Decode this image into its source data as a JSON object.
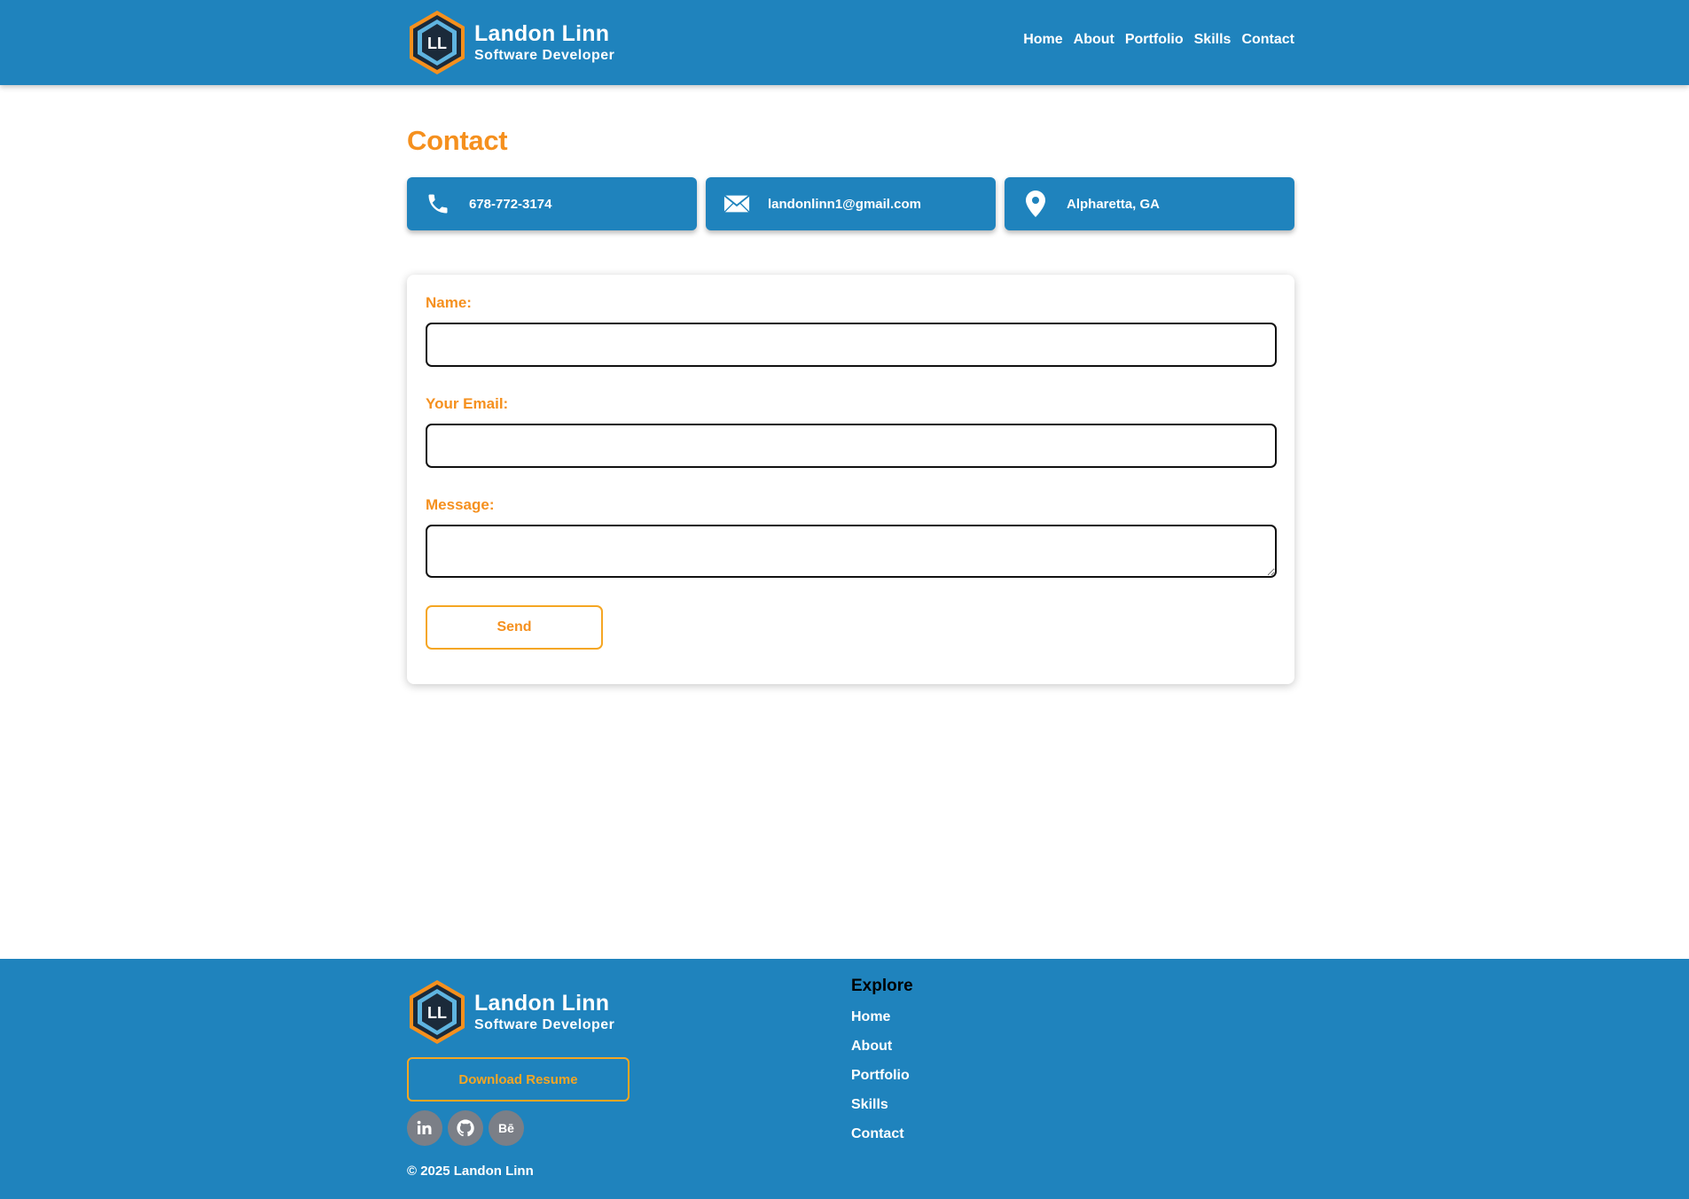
{
  "header": {
    "logo_monogram": "LL",
    "name": "Landon Linn",
    "role": "Software Developer",
    "nav": [
      "Home",
      "About",
      "Portfolio",
      "Skills",
      "Contact"
    ]
  },
  "main": {
    "title": "Contact",
    "contact_cards": [
      {
        "icon": "phone-icon",
        "text": "678-772-3174"
      },
      {
        "icon": "envelope-icon",
        "text": "landonlinn1@gmail.com"
      },
      {
        "icon": "map-pin-icon",
        "text": "Alpharetta, GA"
      }
    ],
    "form": {
      "name_label": "Name:",
      "name_value": "",
      "email_label": "Your Email:",
      "email_value": "",
      "message_label": "Message:",
      "message_value": "",
      "send_label": "Send"
    }
  },
  "footer": {
    "logo_monogram": "LL",
    "name": "Landon Linn",
    "role": "Software Developer",
    "download_label": "Download Resume",
    "socials": [
      "linkedin-icon",
      "github-icon",
      "behance-icon"
    ],
    "copyright": "© 2025 Landon Linn",
    "explore_title": "Explore",
    "explore_links": [
      "Home",
      "About",
      "Portfolio",
      "Skills",
      "Contact"
    ]
  },
  "colors": {
    "primary_blue": "#1f83bd",
    "accent_orange": "#f5901e",
    "social_gray": "#7b7f87"
  }
}
